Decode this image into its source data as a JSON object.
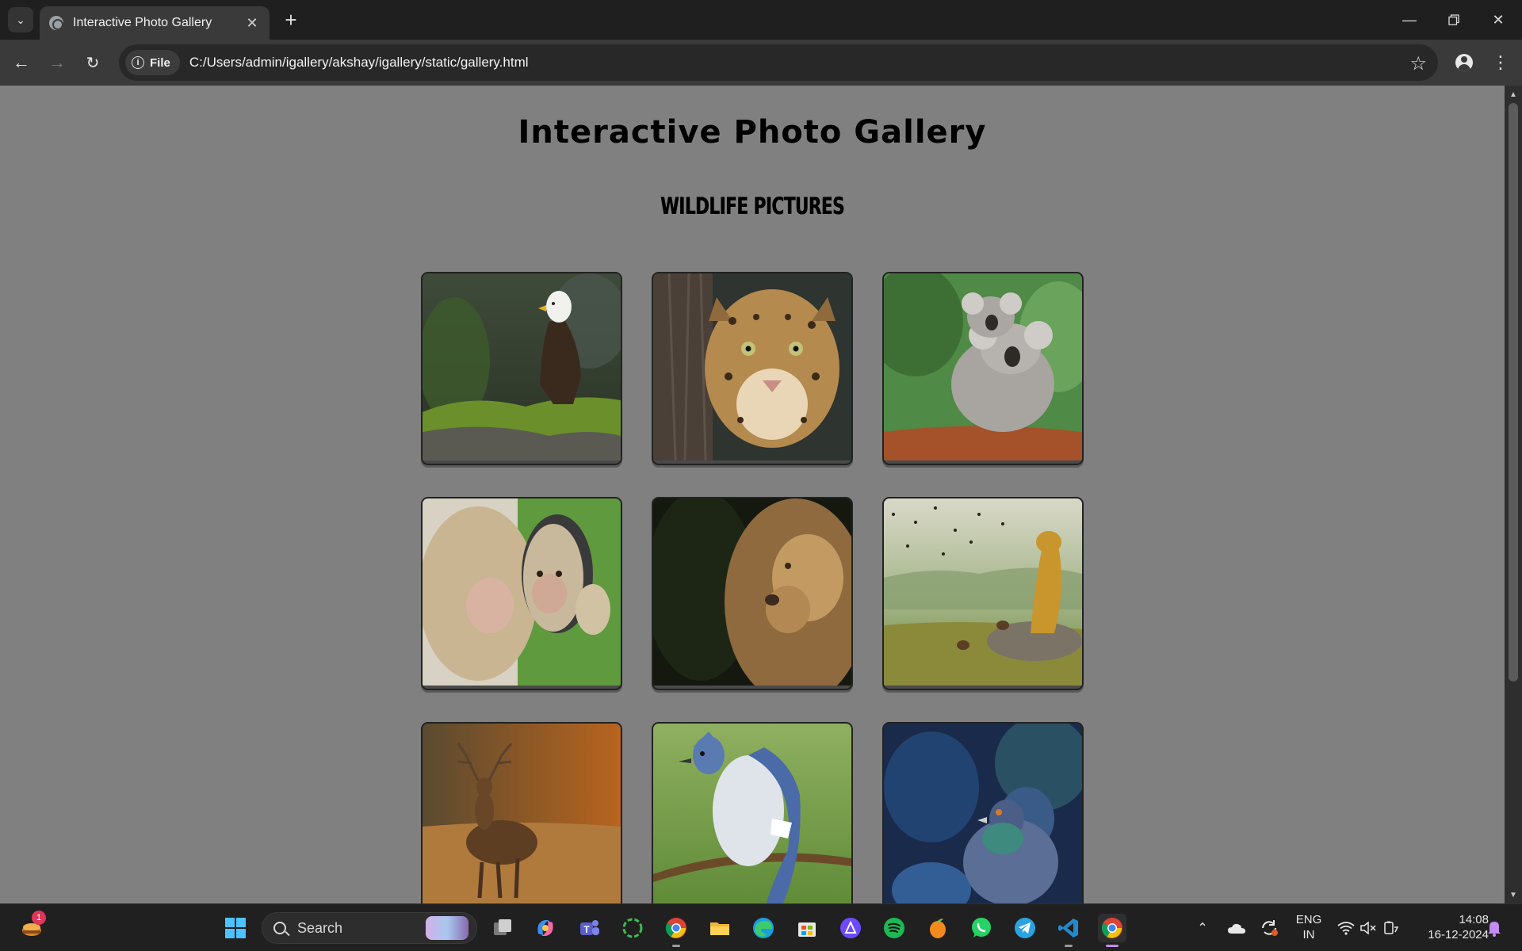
{
  "browser": {
    "tab_title": "Interactive Photo Gallery",
    "new_tab_label": "+",
    "close_tab_label": "✕",
    "address_chip": "File",
    "url": "C:/Users/admin/igallery/akshay/igallery/static/gallery.html"
  },
  "page": {
    "title": "Interactive Photo Gallery",
    "section_title": "WILDLIFE PICTURES",
    "photos": [
      {
        "subject": "bald eagle"
      },
      {
        "subject": "leopard"
      },
      {
        "subject": "koalas"
      },
      {
        "subject": "monkey with mirror"
      },
      {
        "subject": "lion"
      },
      {
        "subject": "cheetah with birds"
      },
      {
        "subject": "deer"
      },
      {
        "subject": "blue jay"
      },
      {
        "subject": "pigeons"
      }
    ]
  },
  "taskbar": {
    "search_label": "Search",
    "notification_count": "1",
    "language": "ENG",
    "region": "IN",
    "time": "14:08",
    "date": "16-12-2024"
  },
  "colors": {
    "page_background": "#808080",
    "chrome_background": "#1f1f1f",
    "accent": "#c48bf0"
  }
}
